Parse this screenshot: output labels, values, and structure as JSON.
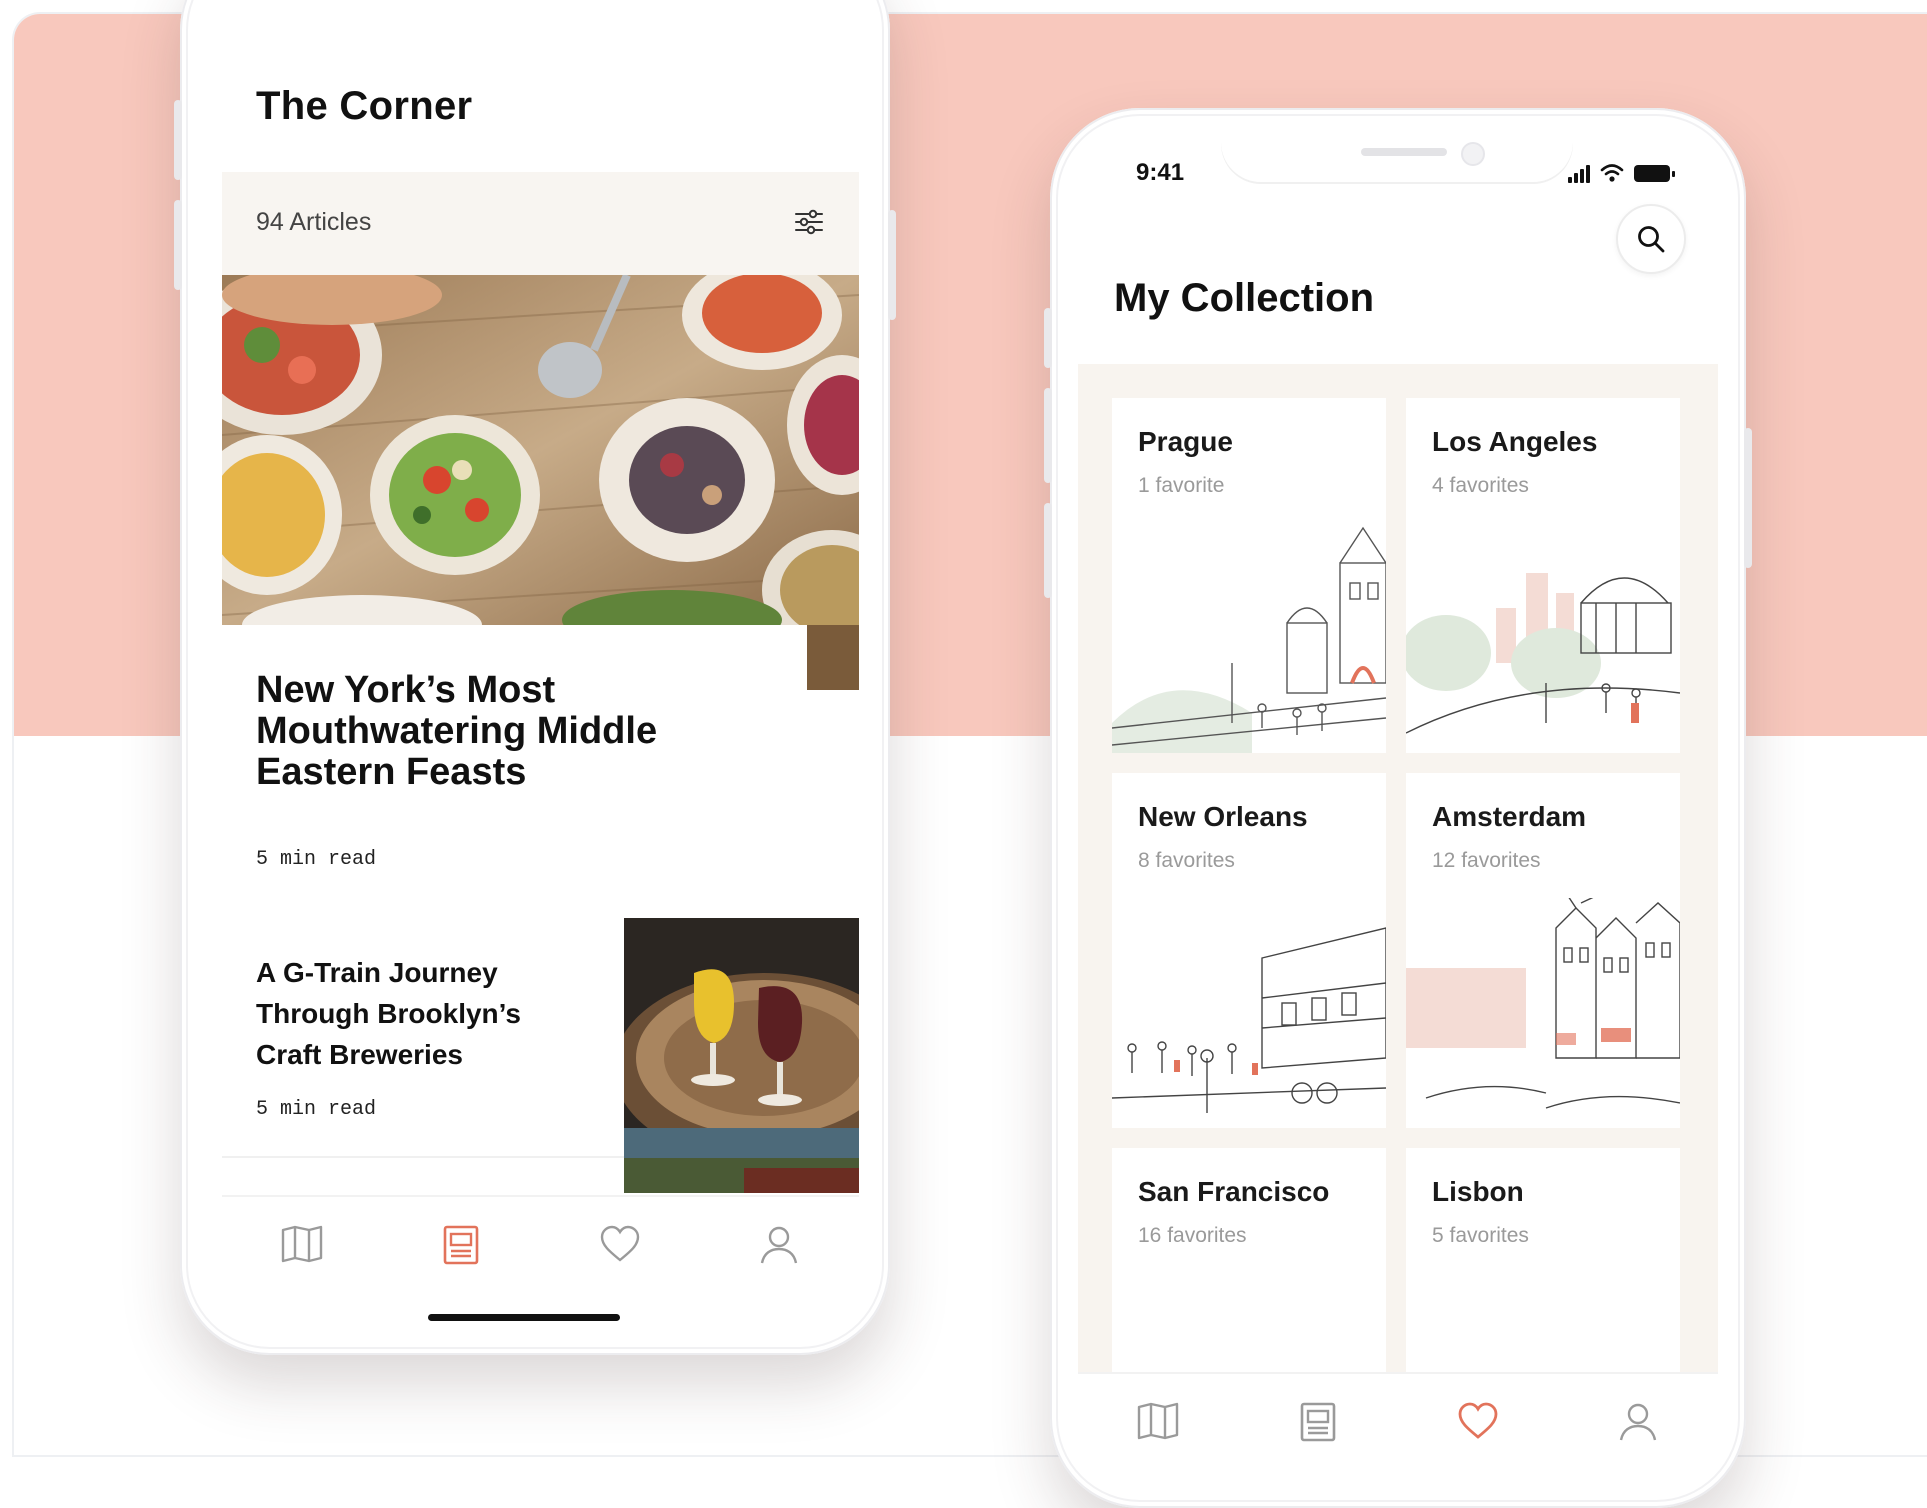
{
  "phone1": {
    "title": "The Corner",
    "article_count": "94 Articles",
    "filter_icon": "sliders-icon",
    "featured": {
      "title": "New York’s Most Mouthwatering Middle Eastern Feasts",
      "read_time": "5 min read"
    },
    "second": {
      "title": "A G-Train Journey Through Brooklyn’s Craft Breweries",
      "read_time": "5 min read"
    },
    "tabs": [
      {
        "icon": "map-icon",
        "active": false
      },
      {
        "icon": "articles-icon",
        "active": true
      },
      {
        "icon": "heart-icon",
        "active": false
      },
      {
        "icon": "profile-icon",
        "active": false
      }
    ]
  },
  "phone2": {
    "status": {
      "time": "9:41"
    },
    "title": "My Collection",
    "search_icon": "search-icon",
    "cities": [
      {
        "name": "Prague",
        "favorites": "1 favorite"
      },
      {
        "name": "Los Angeles",
        "favorites": "4 favorites"
      },
      {
        "name": "New Orleans",
        "favorites": "8 favorites"
      },
      {
        "name": "Amsterdam",
        "favorites": "12 favorites"
      },
      {
        "name": "San Francisco",
        "favorites": "16 favorites"
      },
      {
        "name": "Lisbon",
        "favorites": "5 favorites"
      }
    ],
    "tabs": [
      {
        "icon": "map-icon",
        "active": false
      },
      {
        "icon": "articles-icon",
        "active": false
      },
      {
        "icon": "heart-icon",
        "active": true
      },
      {
        "icon": "profile-icon",
        "active": false
      }
    ]
  },
  "colors": {
    "band": "#f8c8bd",
    "accent": "#e2735b",
    "card_bg": "#f8f4ef",
    "icon_gray": "#9a9a9a"
  }
}
